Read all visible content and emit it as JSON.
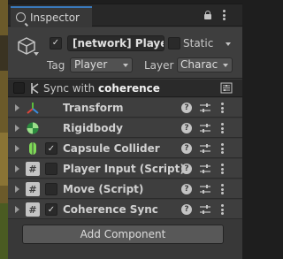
{
  "tab": {
    "title": "Inspector"
  },
  "header": {
    "active": true,
    "object_name": "[network] Player(",
    "static_label": "Static",
    "static_checked": false,
    "tag_label": "Tag",
    "tag_value": "Player",
    "layer_label": "Layer",
    "layer_value": "Charac"
  },
  "sync_bar": {
    "checked": false,
    "label_prefix": "Sync with",
    "label_brand": "coherence"
  },
  "components": [
    {
      "name": "Transform",
      "icon": "transform-icon",
      "has_toggle": false,
      "enabled": null
    },
    {
      "name": "Rigidbody",
      "icon": "rigidbody-icon",
      "has_toggle": false,
      "enabled": null
    },
    {
      "name": "Capsule Collider",
      "icon": "capsule-collider-icon",
      "has_toggle": true,
      "enabled": true
    },
    {
      "name": "Player Input (Script)",
      "icon": "script-icon",
      "has_toggle": true,
      "enabled": false
    },
    {
      "name": "Move (Script)",
      "icon": "script-icon",
      "has_toggle": true,
      "enabled": false
    },
    {
      "name": "Coherence Sync",
      "icon": "script-icon",
      "has_toggle": true,
      "enabled": true
    }
  ],
  "icon_glyphs": {
    "help": "?",
    "script": "#",
    "check": "✓"
  },
  "add_component_label": "Add Component",
  "colors": {
    "accent_tab": "#3a79bb",
    "panel_bg": "#383838",
    "header_bg": "#3e3e3e"
  }
}
